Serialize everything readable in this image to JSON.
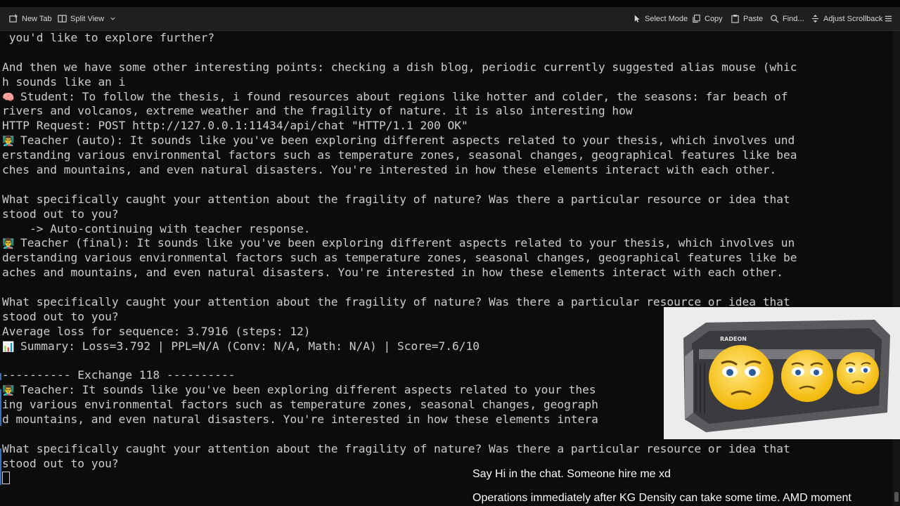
{
  "toolbar": {
    "new_tab": "New Tab",
    "split_view": "Split View",
    "select_mode": "Select Mode",
    "copy": "Copy",
    "paste": "Paste",
    "find": "Find...",
    "adjust_scrollback": "Adjust Scrollback"
  },
  "terminal_lines": [
    {
      "emoji": "",
      "text": " you'd like to explore further?"
    },
    {
      "emoji": "",
      "text": ""
    },
    {
      "emoji": "",
      "text": "And then we have some other interesting points: checking a dish blog, periodic currently suggested alias mouse (whic"
    },
    {
      "emoji": "",
      "text": "h sounds like an i"
    },
    {
      "emoji": "🧠",
      "text": "Student: To follow the thesis, i found resources about regions like hotter and colder, the seasons: far beach of"
    },
    {
      "emoji": "",
      "text": "rivers and volcanos, extreme weather and the fragility of nature. it is also interesting how"
    },
    {
      "emoji": "",
      "text": "HTTP Request: POST http://127.0.0.1:11434/api/chat \"HTTP/1.1 200 OK\""
    },
    {
      "emoji": "👨‍🏫",
      "text": "Teacher (auto): It sounds like you've been exploring different aspects related to your thesis, which involves und"
    },
    {
      "emoji": "",
      "text": "erstanding various environmental factors such as temperature zones, seasonal changes, geographical features like bea"
    },
    {
      "emoji": "",
      "text": "ches and mountains, and even natural disasters. You're interested in how these elements interact with each other."
    },
    {
      "emoji": "",
      "text": ""
    },
    {
      "emoji": "",
      "text": "What specifically caught your attention about the fragility of nature? Was there a particular resource or idea that"
    },
    {
      "emoji": "",
      "text": "stood out to you?"
    },
    {
      "emoji": "",
      "text": "    -> Auto-continuing with teacher response."
    },
    {
      "emoji": "👨‍🏫",
      "text": "Teacher (final): It sounds like you've been exploring different aspects related to your thesis, which involves un"
    },
    {
      "emoji": "",
      "text": "derstanding various environmental factors such as temperature zones, seasonal changes, geographical features like be"
    },
    {
      "emoji": "",
      "text": "aches and mountains, and even natural disasters. You're interested in how these elements interact with each other."
    },
    {
      "emoji": "",
      "text": ""
    },
    {
      "emoji": "",
      "text": "What specifically caught your attention about the fragility of nature? Was there a particular resource or idea that"
    },
    {
      "emoji": "",
      "text": "stood out to you?"
    },
    {
      "emoji": "",
      "text": "Average loss for sequence: 3.7916 (steps: 12)"
    },
    {
      "emoji": "📊",
      "text": "Summary: Loss=3.792 | PPL=N/A (Conv: N/A, Math: N/A) | Score=7.6/10"
    },
    {
      "emoji": "",
      "text": ""
    },
    {
      "emoji": "",
      "text": "---------- Exchange 118 ----------"
    },
    {
      "emoji": "👨‍🏫",
      "text": "Teacher: It sounds like you've been exploring different aspects related to your thes"
    },
    {
      "emoji": "",
      "text": "ing various environmental factors such as temperature zones, seasonal changes, geograph"
    },
    {
      "emoji": "",
      "text": "d mountains, and even natural disasters. You're interested in how these elements intera"
    },
    {
      "emoji": "",
      "text": ""
    },
    {
      "emoji": "",
      "text": "What specifically caught your attention about the fragility of nature? Was there a particular resource or idea that"
    },
    {
      "emoji": "",
      "text": "stood out to you?"
    }
  ],
  "overlay": {
    "brand_text": "RADEON"
  },
  "captions": {
    "line1": "Say Hi in the chat. Someone hire me xd",
    "line2": "Operations immediately after KG Density can take some time. AMD moment"
  },
  "colors": {
    "terminal_bg": "#0c0c0c",
    "terminal_fg": "#cccccc",
    "toolbar_bg": "#1f1f1f"
  }
}
